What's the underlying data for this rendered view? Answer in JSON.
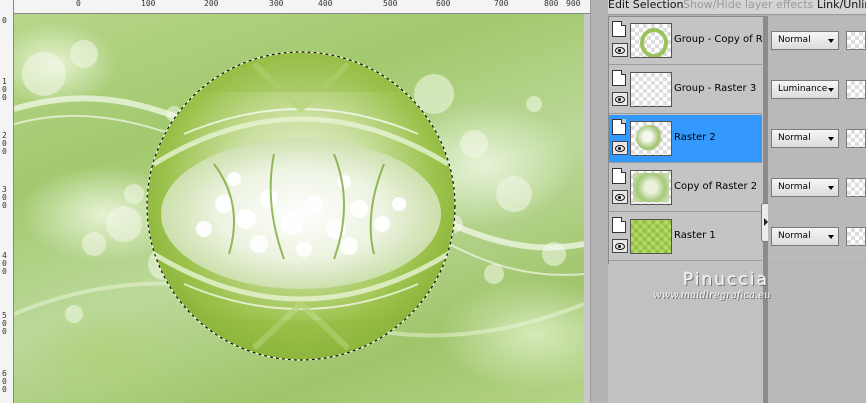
{
  "toolbar": {
    "edit_selection": "Edit Selection",
    "show_hide_effects": "Show/Hide layer effects",
    "link_unlink": "Link/Unlink"
  },
  "rulers": {
    "top": [
      "0",
      "100",
      "200",
      "300",
      "400",
      "500",
      "600",
      "700",
      "800",
      "900"
    ],
    "left": [
      "0",
      "1\n0\n0",
      "2\n0\n0",
      "3\n0\n0",
      "4\n0\n0",
      "5\n0\n0",
      "6\n0\n0"
    ]
  },
  "layers": [
    {
      "name": "Group - Copy of Raster",
      "blend": "Normal",
      "thumb": "ring",
      "selected": false
    },
    {
      "name": "Group - Raster 3",
      "blend": "Luminance",
      "thumb": "empty",
      "selected": false
    },
    {
      "name": "Raster 2",
      "blend": "Normal",
      "thumb": "flowers",
      "selected": true
    },
    {
      "name": "Copy of Raster 2",
      "blend": "Normal",
      "thumb": "flowers-bg",
      "selected": false
    },
    {
      "name": "Raster 1",
      "blend": "Normal",
      "thumb": "green-pattern",
      "selected": false
    }
  ],
  "icons": {
    "mask": "layer-mask-icon",
    "visibility": "eye-icon",
    "dropdown": "chevron-down-icon",
    "grip": "chevron-right-icon"
  },
  "colors": {
    "selection": "#3399ff",
    "panel_bg": "#c4c4c4",
    "canvas_green": "#a2c96e"
  },
  "credit": {
    "name": "Pinuccia",
    "url": "www.maidiregrafica.eu"
  }
}
